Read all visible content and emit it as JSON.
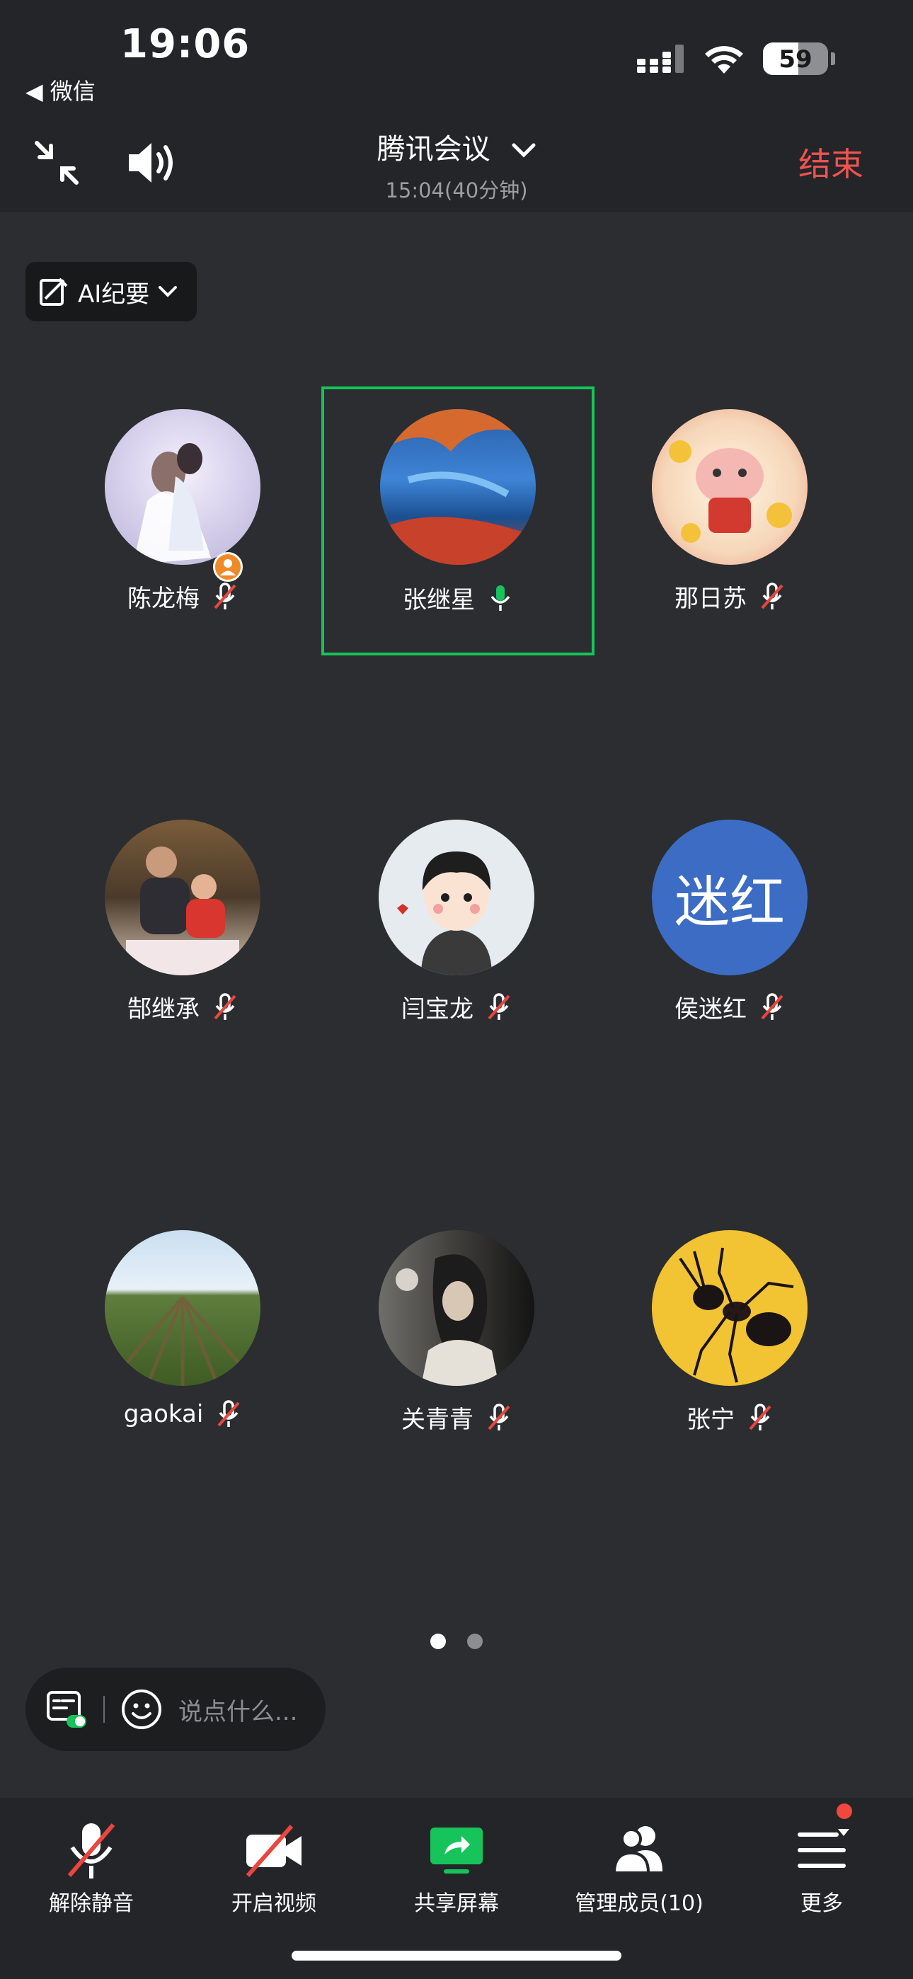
{
  "status_bar": {
    "time": "19:06",
    "back_label": "◀ 微信",
    "battery": "59"
  },
  "header": {
    "title": "腾讯会议",
    "subtitle": "15:04(40分钟)",
    "end_label": "结束"
  },
  "ai_summary": {
    "label": "AI纪要"
  },
  "participants": [
    {
      "name": "陈龙梅",
      "mic": "muted",
      "avatar": "photo-wedding",
      "host": true
    },
    {
      "name": "张继星",
      "mic": "active",
      "avatar": "photo-lake",
      "speaking": true
    },
    {
      "name": "那日苏",
      "mic": "muted",
      "avatar": "cartoon-pig"
    },
    {
      "name": "郜继承",
      "mic": "muted",
      "avatar": "photo-family"
    },
    {
      "name": "闫宝龙",
      "mic": "muted",
      "avatar": "cartoon-boy"
    },
    {
      "name": "侯迷红",
      "mic": "muted",
      "avatar": "initials",
      "initials": "迷红",
      "color": "#3d6cc5"
    },
    {
      "name": "gaokai",
      "mic": "muted",
      "avatar": "photo-field"
    },
    {
      "name": "关青青",
      "mic": "muted",
      "avatar": "photo-woman"
    },
    {
      "name": "张宁",
      "mic": "muted",
      "avatar": "photo-ant"
    }
  ],
  "pager": {
    "pages": 2,
    "current": 1
  },
  "chat": {
    "placeholder": "说点什么..."
  },
  "toolbar": {
    "unmute": "解除静音",
    "video": "开启视频",
    "share": "共享屏幕",
    "members": "管理成员(10)",
    "more": "更多"
  },
  "colors": {
    "accent_green": "#17c35b",
    "end_red": "#f0524f",
    "muted_red": "#e8463f"
  }
}
